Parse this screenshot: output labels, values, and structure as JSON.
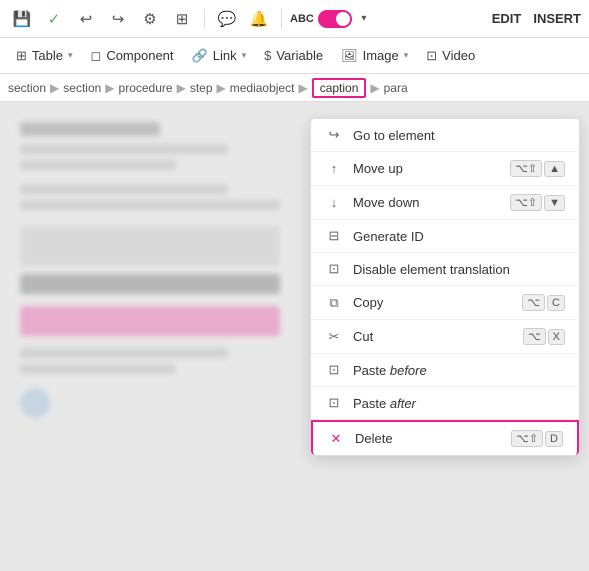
{
  "toolbar": {
    "icons": [
      {
        "name": "save-icon",
        "symbol": "💾"
      },
      {
        "name": "check-icon",
        "symbol": "✓"
      },
      {
        "name": "undo-icon",
        "symbol": "↩"
      },
      {
        "name": "redo-icon",
        "symbol": "↪"
      },
      {
        "name": "settings-icon",
        "symbol": "⚙"
      },
      {
        "name": "layout-icon",
        "symbol": "⊞"
      },
      {
        "name": "comment-icon",
        "symbol": "💬"
      },
      {
        "name": "bell-icon",
        "symbol": "🔔"
      },
      {
        "name": "text-icon",
        "symbol": "ABC"
      }
    ],
    "edit_label": "EDIT",
    "insert_label": "INSERT"
  },
  "insert_toolbar": {
    "items": [
      {
        "name": "table-item",
        "icon": "⊞",
        "label": "Table",
        "has_chevron": true
      },
      {
        "name": "component-item",
        "icon": "◻",
        "label": "Component",
        "has_chevron": false
      },
      {
        "name": "link-item",
        "icon": "🔗",
        "label": "Link",
        "has_chevron": true
      },
      {
        "name": "variable-item",
        "icon": "$",
        "label": "Variable",
        "has_chevron": false
      },
      {
        "name": "image-item",
        "icon": "🖼",
        "label": "Image",
        "has_chevron": true
      },
      {
        "name": "video-item",
        "icon": "⊡",
        "label": "Video",
        "has_chevron": false
      }
    ]
  },
  "breadcrumb": {
    "items": [
      "section",
      "section",
      "procedure",
      "step",
      "mediaobject"
    ],
    "active": "caption",
    "after": "para"
  },
  "context_menu": {
    "items": [
      {
        "name": "go-to-element",
        "icon": "↪",
        "label": "Go to element",
        "shortcut": null
      },
      {
        "name": "move-up",
        "icon": "↑",
        "label": "Move up",
        "shortcut": [
          "⌥⇧",
          "▲"
        ]
      },
      {
        "name": "move-down",
        "icon": "↓",
        "label": "Move down",
        "shortcut": [
          "⌥⇧",
          "▼"
        ]
      },
      {
        "name": "generate-id",
        "icon": "⊟",
        "label": "Generate ID",
        "shortcut": null
      },
      {
        "name": "disable-translation",
        "icon": "⊡",
        "label": "Disable element translation",
        "shortcut": null
      },
      {
        "name": "copy",
        "icon": "⧉",
        "label": "Copy",
        "shortcut": [
          "⌥",
          "C"
        ]
      },
      {
        "name": "cut",
        "icon": "✂",
        "label": "Cut",
        "shortcut": [
          "⌥",
          "X"
        ]
      },
      {
        "name": "paste-before",
        "icon": "⊡",
        "label": "Paste before",
        "label_em": null,
        "italic_part": "before",
        "shortcut": null
      },
      {
        "name": "paste-after",
        "icon": "⊡",
        "label": "Paste after",
        "label_em": null,
        "italic_part": "after",
        "shortcut": null
      },
      {
        "name": "delete",
        "icon": "✕",
        "label": "Delete",
        "shortcut": [
          "⌥⇧",
          "D"
        ],
        "is_delete": true
      }
    ]
  }
}
